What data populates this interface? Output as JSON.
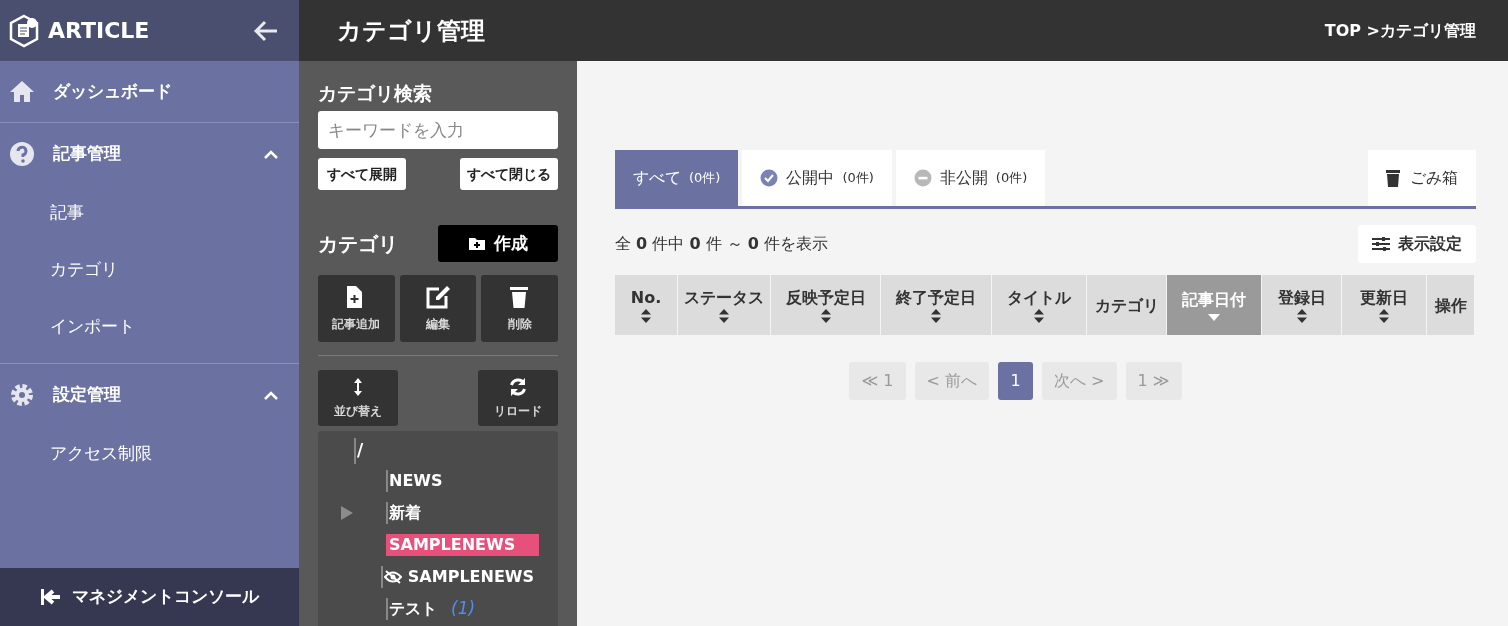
{
  "app": {
    "title": "ARTICLE"
  },
  "sidebar": {
    "items": [
      {
        "kind": "link",
        "label": "ダッシュボード"
      },
      {
        "kind": "group",
        "label": "記事管理",
        "expanded": true,
        "children": [
          {
            "label": "記事"
          },
          {
            "label": "カテゴリ"
          },
          {
            "label": "インポート"
          }
        ]
      },
      {
        "kind": "group",
        "label": "設定管理",
        "expanded": true,
        "children": [
          {
            "label": "アクセス制限"
          }
        ]
      }
    ],
    "footer": "マネジメントコンソール"
  },
  "header": {
    "title": "カテゴリ管理",
    "breadcrumb": "TOP >カテゴリ管理"
  },
  "category_panel": {
    "search_title": "カテゴリ検索",
    "search": {
      "placeholder": "キーワードを入力"
    },
    "expand_all": "すべて展開",
    "collapse_all": "すべて閉じる",
    "title": "カテゴリ",
    "create": "作成",
    "tools": [
      {
        "label": "記事追加"
      },
      {
        "label": "編集"
      },
      {
        "label": "削除"
      }
    ],
    "sort": "並び替え",
    "reload": "リロード",
    "tree": {
      "label": "/",
      "children": [
        {
          "label": "NEWS",
          "selected": false,
          "hidden": false,
          "expandable": false
        },
        {
          "label": "新着",
          "selected": false,
          "hidden": false,
          "expandable": true
        },
        {
          "label": "SAMPLENEWS",
          "selected": true,
          "hidden": false,
          "expandable": false
        },
        {
          "label": "SAMPLENEWS",
          "selected": false,
          "hidden": true,
          "expandable": false
        },
        {
          "label": "テスト",
          "count": "(1)",
          "selected": false,
          "hidden": false,
          "expandable": false
        }
      ]
    }
  },
  "tabs": [
    {
      "kind": "all",
      "label": "すべて",
      "count": "(0件)",
      "selected": true
    },
    {
      "kind": "public",
      "label": "公開中",
      "count": "(0件)",
      "selected": false
    },
    {
      "kind": "private",
      "label": "非公開",
      "count": "(0件)",
      "selected": false
    }
  ],
  "trash": "ごみ箱",
  "summary": "全 **0** 件中 **0** 件 ～ **0** 件を表示",
  "display_settings": "表示設定",
  "table": {
    "columns": [
      {
        "label": "No.",
        "sortable": true,
        "selected": false
      },
      {
        "label": "ステータス",
        "sortable": true,
        "selected": false
      },
      {
        "label": "反映予定日",
        "sortable": true,
        "selected": false
      },
      {
        "label": "終了予定日",
        "sortable": true,
        "selected": false
      },
      {
        "label": "タイトル",
        "sortable": true,
        "selected": false
      },
      {
        "label": "カテゴリ",
        "sortable": false,
        "selected": false
      },
      {
        "label": "記事日付",
        "sortable": true,
        "selected": true
      },
      {
        "label": "登録日",
        "sortable": true,
        "selected": false
      },
      {
        "label": "更新日",
        "sortable": true,
        "selected": false
      },
      {
        "label": "操作",
        "sortable": false,
        "selected": false
      }
    ]
  },
  "pagination": [
    {
      "label": "≪ 1",
      "selected": false,
      "disabled": true
    },
    {
      "label": "< 前へ",
      "selected": false,
      "disabled": true
    },
    {
      "label": "1",
      "selected": true,
      "disabled": false
    },
    {
      "label": "次へ >",
      "selected": false,
      "disabled": true
    },
    {
      "label": "1 ≫",
      "selected": false,
      "disabled": true
    }
  ]
}
